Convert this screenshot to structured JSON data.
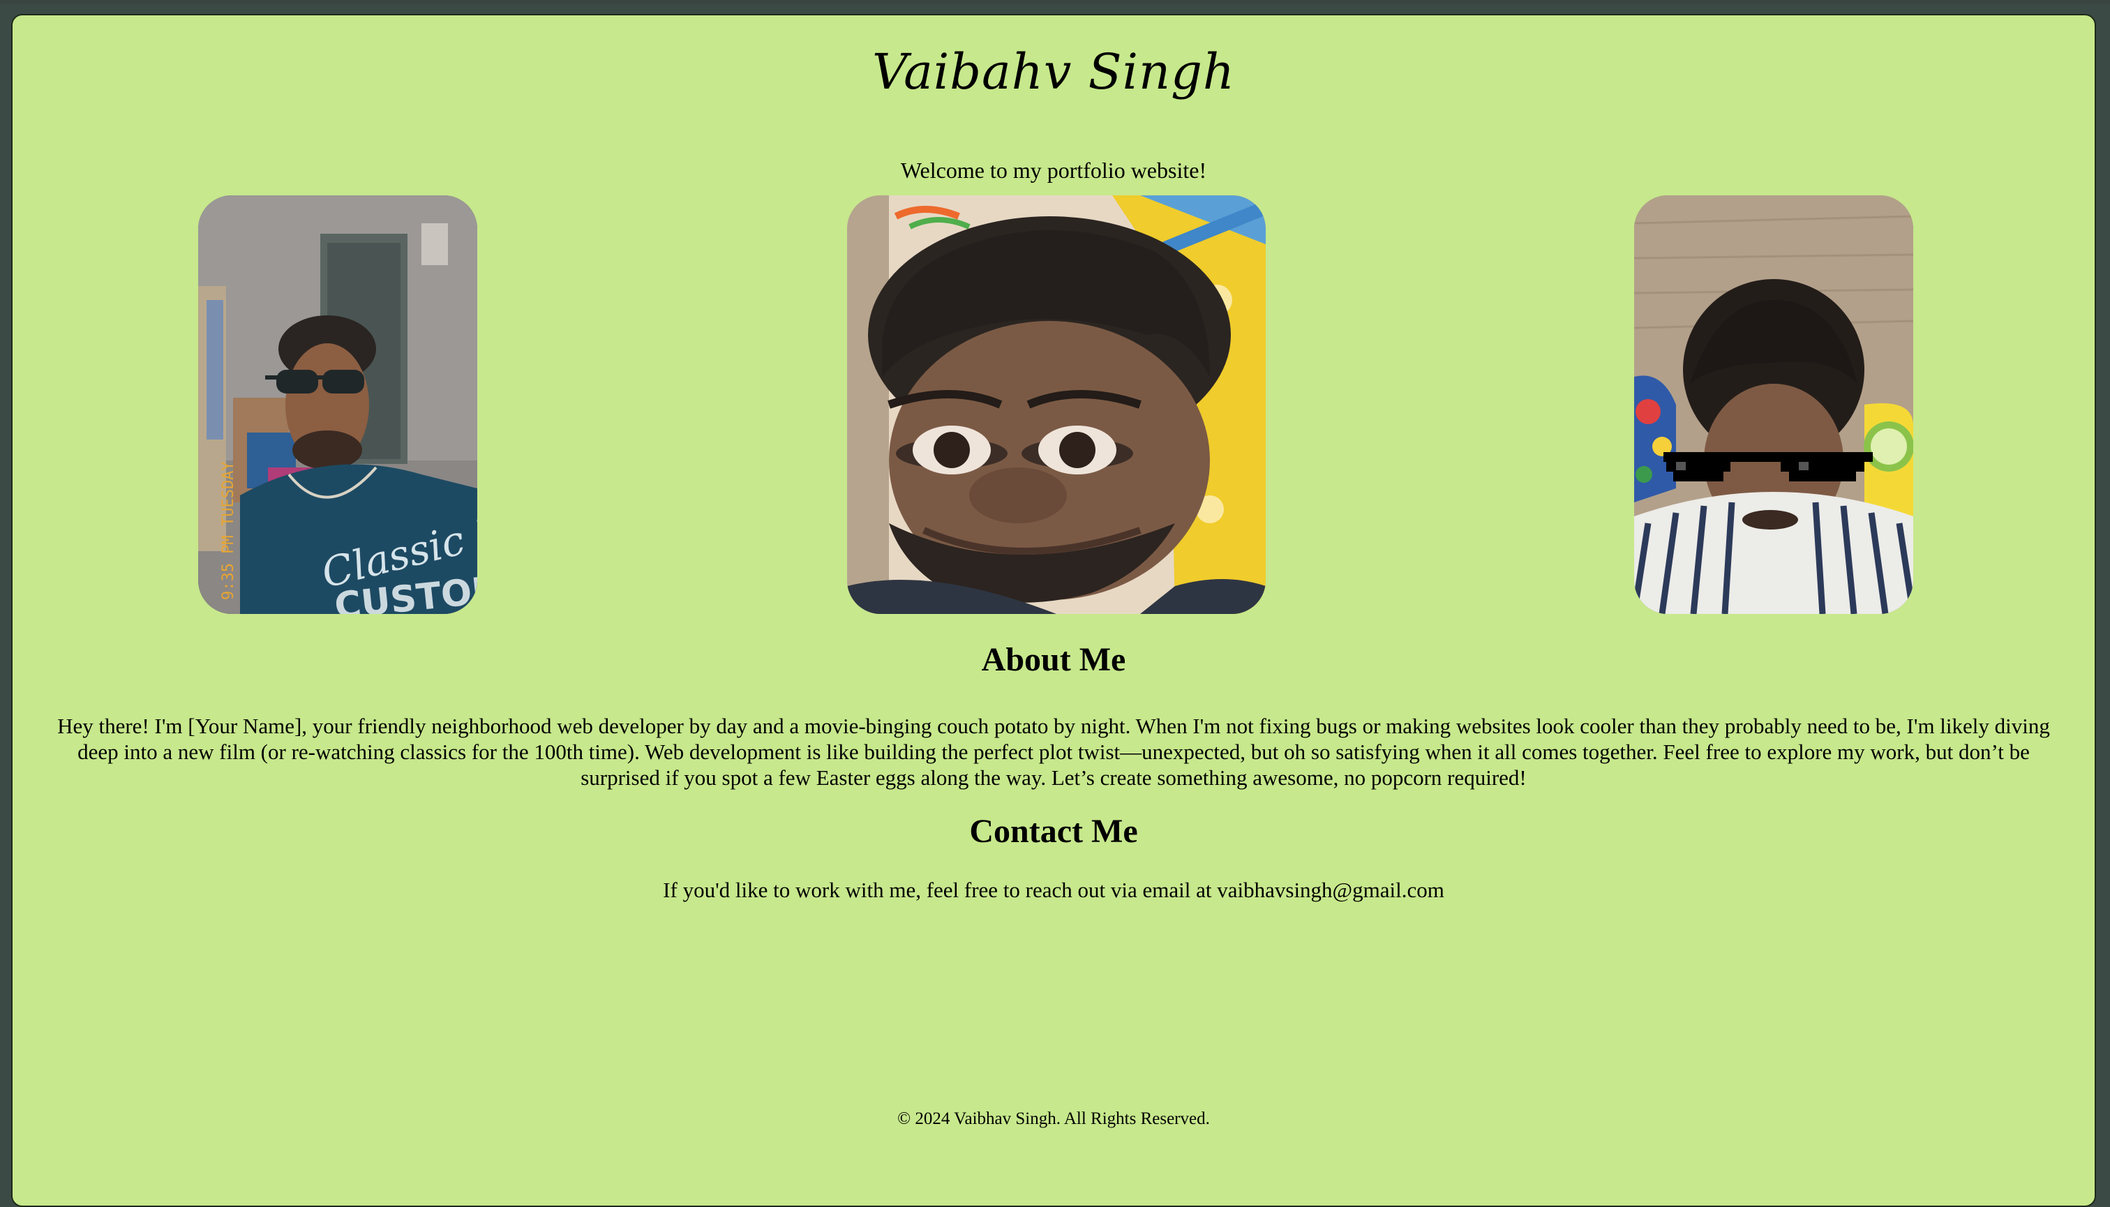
{
  "site": {
    "title": "Vaibahv Singh",
    "welcome": "Welcome to my portfolio website!"
  },
  "photos": [
    {
      "icon": "portrait-photo-sunglasses",
      "overlay_text": "9:35 PM TUESDAY"
    },
    {
      "icon": "portrait-photo-face-warp"
    },
    {
      "icon": "portrait-photo-pixel-glasses"
    }
  ],
  "about": {
    "heading": "About Me",
    "text": "Hey there! I'm [Your Name], your friendly neighborhood web developer by day and a movie-binging couch potato by night. When I'm not fixing bugs or making websites look cooler than they probably need to be, I'm likely diving deep into a new film (or re-watching classics for the 100th time). Web development is like building the perfect plot twist—unexpected, but oh so satisfying when it all comes together. Feel free to explore my work, but don’t be surprised if you spot a few Easter eggs along the way. Let’s create something awesome, no popcorn required!"
  },
  "contact": {
    "heading": "Contact Me",
    "text": "If you'd like to work with me, feel free to reach out via email at vaibhavsingh@gmail.com"
  },
  "footer": {
    "text": "© 2024 Vaibhav Singh. All Rights Reserved."
  },
  "colors": {
    "page_background": "#c7e88c",
    "outer_background": "#3b4a45",
    "text": "#000000"
  }
}
